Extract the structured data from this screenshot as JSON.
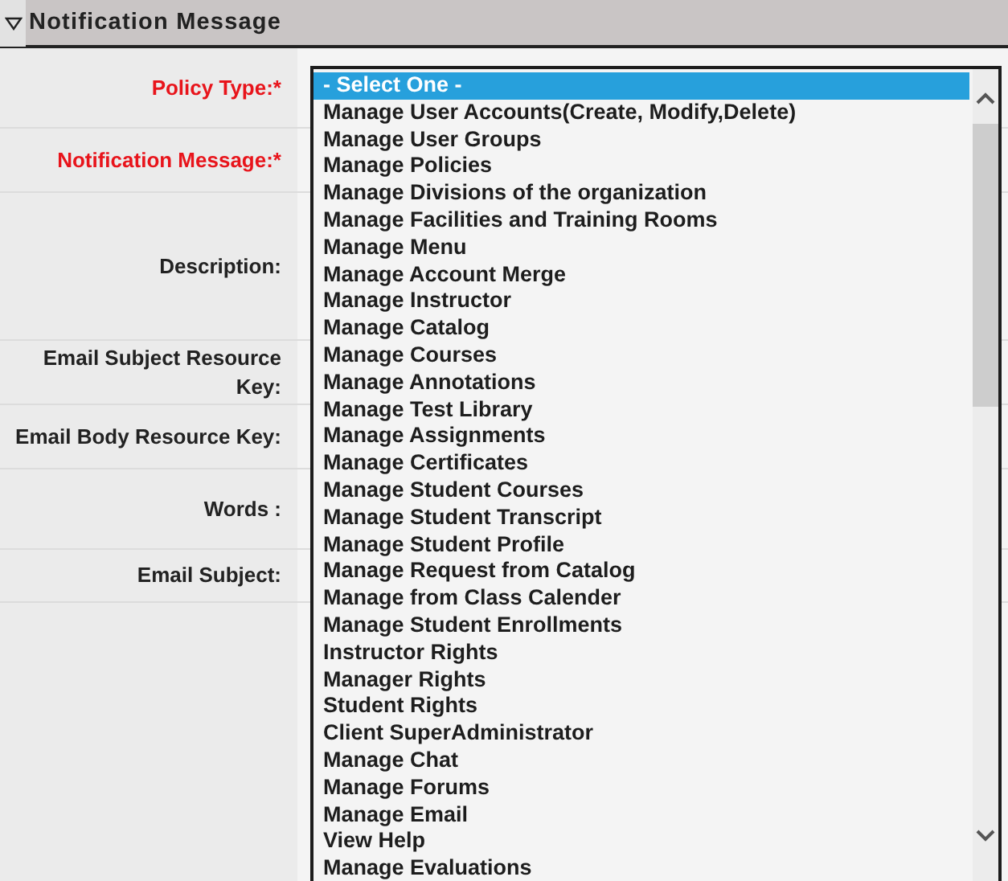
{
  "section": {
    "title": "Notification Message",
    "expanded": true
  },
  "fields": [
    {
      "label": "Policy Type:*",
      "required": true,
      "kind": "select"
    },
    {
      "label": "Notification Message:*",
      "required": true,
      "kind": "text"
    },
    {
      "label": "Description:",
      "required": false,
      "kind": "textarea"
    },
    {
      "label": "Email Subject Resource Key:",
      "required": false,
      "kind": "text"
    },
    {
      "label": "Email Body Resource Key:",
      "required": false,
      "kind": "text"
    },
    {
      "label": "Words :",
      "required": false,
      "kind": "counter"
    },
    {
      "label": "Email Subject:",
      "required": false,
      "kind": "short"
    }
  ],
  "dropdown": {
    "options": [
      {
        "label": "- Select One -",
        "selected": true
      },
      {
        "label": "Manage User Accounts(Create, Modify,Delete)",
        "selected": false
      },
      {
        "label": "Manage User Groups",
        "selected": false
      },
      {
        "label": "Manage Policies",
        "selected": false
      },
      {
        "label": "Manage Divisions of the organization",
        "selected": false
      },
      {
        "label": "Manage Facilities and Training Rooms",
        "selected": false
      },
      {
        "label": "Manage Menu",
        "selected": false
      },
      {
        "label": "Manage Account Merge",
        "selected": false
      },
      {
        "label": "Manage Instructor",
        "selected": false
      },
      {
        "label": "Manage Catalog",
        "selected": false
      },
      {
        "label": "Manage Courses",
        "selected": false
      },
      {
        "label": "Manage Annotations",
        "selected": false
      },
      {
        "label": "Manage Test Library",
        "selected": false
      },
      {
        "label": "Manage Assignments",
        "selected": false
      },
      {
        "label": "Manage Certificates",
        "selected": false
      },
      {
        "label": "Manage Student Courses",
        "selected": false
      },
      {
        "label": "Manage Student Transcript",
        "selected": false
      },
      {
        "label": "Manage Student Profile",
        "selected": false
      },
      {
        "label": "Manage Request from Catalog",
        "selected": false
      },
      {
        "label": "Manage from Class Calender",
        "selected": false
      },
      {
        "label": "Manage Student Enrollments",
        "selected": false
      },
      {
        "label": "Instructor Rights",
        "selected": false
      },
      {
        "label": "Manager Rights",
        "selected": false
      },
      {
        "label": "Student Rights",
        "selected": false
      },
      {
        "label": "Client SuperAdministrator",
        "selected": false
      },
      {
        "label": "Manage Chat",
        "selected": false
      },
      {
        "label": "Manage Forums",
        "selected": false
      },
      {
        "label": "Manage Email",
        "selected": false
      },
      {
        "label": "View Help",
        "selected": false
      },
      {
        "label": "Manage Evaluations",
        "selected": false
      }
    ]
  }
}
